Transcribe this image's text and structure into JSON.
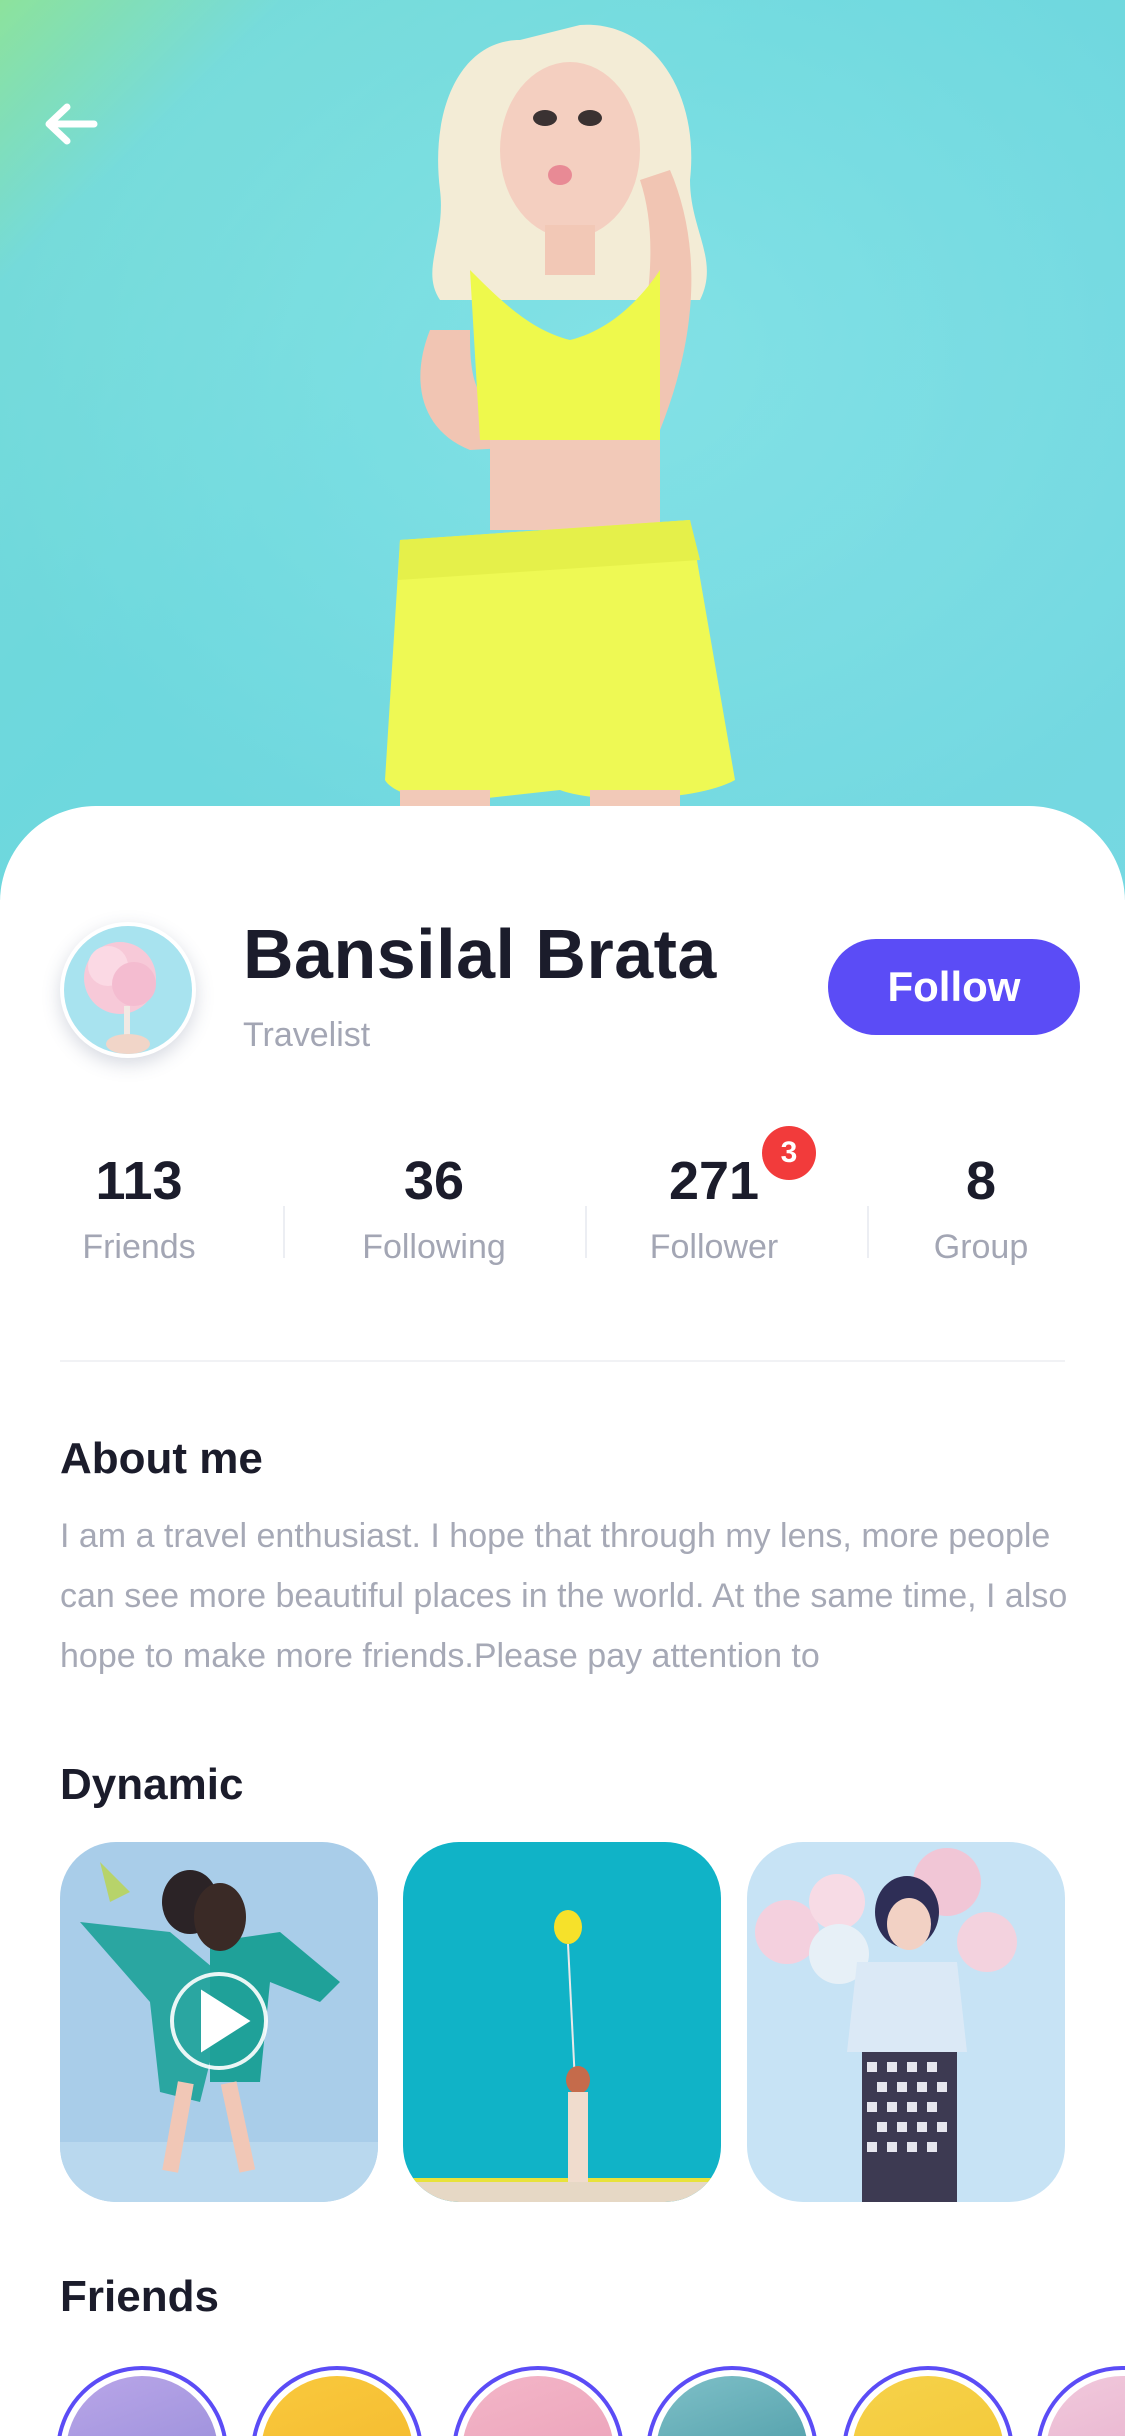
{
  "profile": {
    "name": "Bansilal Brata",
    "role": "Travelist",
    "follow_label": "Follow"
  },
  "stats": [
    {
      "value": "113",
      "label": "Friends"
    },
    {
      "value": "36",
      "label": "Following"
    },
    {
      "value": "271",
      "label": "Follower",
      "badge": "3"
    },
    {
      "value": "8",
      "label": "Group"
    }
  ],
  "about": {
    "title": "About me",
    "text": "I am a travel enthusiast. I hope that through my lens, more people can see more beautiful places in the world. At the same time, I also hope to make more friends.Please pay attention to"
  },
  "dynamic": {
    "title": "Dynamic"
  },
  "friends": {
    "title": "Friends"
  },
  "icons": {
    "back": "arrow-left-icon",
    "play": "play-icon"
  },
  "colors": {
    "accent": "#5b4cf6",
    "badge": "#f23b3b",
    "hero_bg": "#72dcdf"
  }
}
